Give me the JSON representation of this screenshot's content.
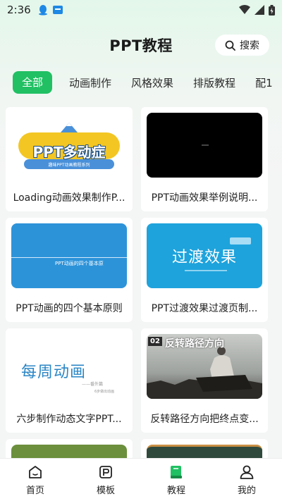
{
  "status": {
    "time": "2:36"
  },
  "header": {
    "title": "PPT教程",
    "search_label": "搜索"
  },
  "tabs": [
    {
      "label": "全部",
      "active": true
    },
    {
      "label": "动画制作",
      "active": false
    },
    {
      "label": "风格效果",
      "active": false
    },
    {
      "label": "排版教程",
      "active": false
    },
    {
      "label": "配1",
      "active": false
    }
  ],
  "cards": [
    {
      "title": "Loading动画效果制作P...",
      "thumb_text": "PPT多动症",
      "thumb_sub": "趣味PPT动画教程系列"
    },
    {
      "title": "PPT动画效果举例说明..."
    },
    {
      "title": "PPT动画的四个基本原则",
      "thumb_text": "PPT动画的四个基本原"
    },
    {
      "title": "PPT过渡效果过渡页制...",
      "thumb_text": "过渡效果"
    },
    {
      "title": "六步制作动态文字PPT...",
      "thumb_text": "每周动画",
      "thumb_sub": "——番外篇",
      "thumb_sub2": "6步做出动画"
    },
    {
      "title": "反转路径方向把终点变...",
      "thumb_text": "反转路径方向",
      "thumb_num": "02"
    }
  ],
  "nav": [
    {
      "label": "首页",
      "icon": "home-icon"
    },
    {
      "label": "模板",
      "icon": "template-icon"
    },
    {
      "label": "教程",
      "icon": "book-icon",
      "active": true
    },
    {
      "label": "我的",
      "icon": "user-icon"
    }
  ],
  "colors": {
    "accent": "#21c063"
  }
}
